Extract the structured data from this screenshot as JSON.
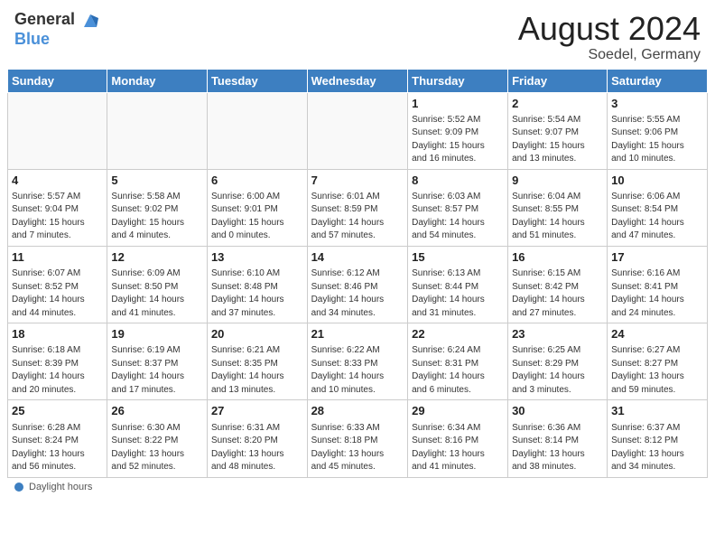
{
  "header": {
    "logo_general": "General",
    "logo_blue": "Blue",
    "month_title": "August 2024",
    "location": "Soedel, Germany"
  },
  "days_of_week": [
    "Sunday",
    "Monday",
    "Tuesday",
    "Wednesday",
    "Thursday",
    "Friday",
    "Saturday"
  ],
  "weeks": [
    [
      {
        "day": "",
        "info": ""
      },
      {
        "day": "",
        "info": ""
      },
      {
        "day": "",
        "info": ""
      },
      {
        "day": "",
        "info": ""
      },
      {
        "day": "1",
        "info": "Sunrise: 5:52 AM\nSunset: 9:09 PM\nDaylight: 15 hours\nand 16 minutes."
      },
      {
        "day": "2",
        "info": "Sunrise: 5:54 AM\nSunset: 9:07 PM\nDaylight: 15 hours\nand 13 minutes."
      },
      {
        "day": "3",
        "info": "Sunrise: 5:55 AM\nSunset: 9:06 PM\nDaylight: 15 hours\nand 10 minutes."
      }
    ],
    [
      {
        "day": "4",
        "info": "Sunrise: 5:57 AM\nSunset: 9:04 PM\nDaylight: 15 hours\nand 7 minutes."
      },
      {
        "day": "5",
        "info": "Sunrise: 5:58 AM\nSunset: 9:02 PM\nDaylight: 15 hours\nand 4 minutes."
      },
      {
        "day": "6",
        "info": "Sunrise: 6:00 AM\nSunset: 9:01 PM\nDaylight: 15 hours\nand 0 minutes."
      },
      {
        "day": "7",
        "info": "Sunrise: 6:01 AM\nSunset: 8:59 PM\nDaylight: 14 hours\nand 57 minutes."
      },
      {
        "day": "8",
        "info": "Sunrise: 6:03 AM\nSunset: 8:57 PM\nDaylight: 14 hours\nand 54 minutes."
      },
      {
        "day": "9",
        "info": "Sunrise: 6:04 AM\nSunset: 8:55 PM\nDaylight: 14 hours\nand 51 minutes."
      },
      {
        "day": "10",
        "info": "Sunrise: 6:06 AM\nSunset: 8:54 PM\nDaylight: 14 hours\nand 47 minutes."
      }
    ],
    [
      {
        "day": "11",
        "info": "Sunrise: 6:07 AM\nSunset: 8:52 PM\nDaylight: 14 hours\nand 44 minutes."
      },
      {
        "day": "12",
        "info": "Sunrise: 6:09 AM\nSunset: 8:50 PM\nDaylight: 14 hours\nand 41 minutes."
      },
      {
        "day": "13",
        "info": "Sunrise: 6:10 AM\nSunset: 8:48 PM\nDaylight: 14 hours\nand 37 minutes."
      },
      {
        "day": "14",
        "info": "Sunrise: 6:12 AM\nSunset: 8:46 PM\nDaylight: 14 hours\nand 34 minutes."
      },
      {
        "day": "15",
        "info": "Sunrise: 6:13 AM\nSunset: 8:44 PM\nDaylight: 14 hours\nand 31 minutes."
      },
      {
        "day": "16",
        "info": "Sunrise: 6:15 AM\nSunset: 8:42 PM\nDaylight: 14 hours\nand 27 minutes."
      },
      {
        "day": "17",
        "info": "Sunrise: 6:16 AM\nSunset: 8:41 PM\nDaylight: 14 hours\nand 24 minutes."
      }
    ],
    [
      {
        "day": "18",
        "info": "Sunrise: 6:18 AM\nSunset: 8:39 PM\nDaylight: 14 hours\nand 20 minutes."
      },
      {
        "day": "19",
        "info": "Sunrise: 6:19 AM\nSunset: 8:37 PM\nDaylight: 14 hours\nand 17 minutes."
      },
      {
        "day": "20",
        "info": "Sunrise: 6:21 AM\nSunset: 8:35 PM\nDaylight: 14 hours\nand 13 minutes."
      },
      {
        "day": "21",
        "info": "Sunrise: 6:22 AM\nSunset: 8:33 PM\nDaylight: 14 hours\nand 10 minutes."
      },
      {
        "day": "22",
        "info": "Sunrise: 6:24 AM\nSunset: 8:31 PM\nDaylight: 14 hours\nand 6 minutes."
      },
      {
        "day": "23",
        "info": "Sunrise: 6:25 AM\nSunset: 8:29 PM\nDaylight: 14 hours\nand 3 minutes."
      },
      {
        "day": "24",
        "info": "Sunrise: 6:27 AM\nSunset: 8:27 PM\nDaylight: 13 hours\nand 59 minutes."
      }
    ],
    [
      {
        "day": "25",
        "info": "Sunrise: 6:28 AM\nSunset: 8:24 PM\nDaylight: 13 hours\nand 56 minutes."
      },
      {
        "day": "26",
        "info": "Sunrise: 6:30 AM\nSunset: 8:22 PM\nDaylight: 13 hours\nand 52 minutes."
      },
      {
        "day": "27",
        "info": "Sunrise: 6:31 AM\nSunset: 8:20 PM\nDaylight: 13 hours\nand 48 minutes."
      },
      {
        "day": "28",
        "info": "Sunrise: 6:33 AM\nSunset: 8:18 PM\nDaylight: 13 hours\nand 45 minutes."
      },
      {
        "day": "29",
        "info": "Sunrise: 6:34 AM\nSunset: 8:16 PM\nDaylight: 13 hours\nand 41 minutes."
      },
      {
        "day": "30",
        "info": "Sunrise: 6:36 AM\nSunset: 8:14 PM\nDaylight: 13 hours\nand 38 minutes."
      },
      {
        "day": "31",
        "info": "Sunrise: 6:37 AM\nSunset: 8:12 PM\nDaylight: 13 hours\nand 34 minutes."
      }
    ]
  ],
  "footer": {
    "label": "Daylight hours"
  }
}
